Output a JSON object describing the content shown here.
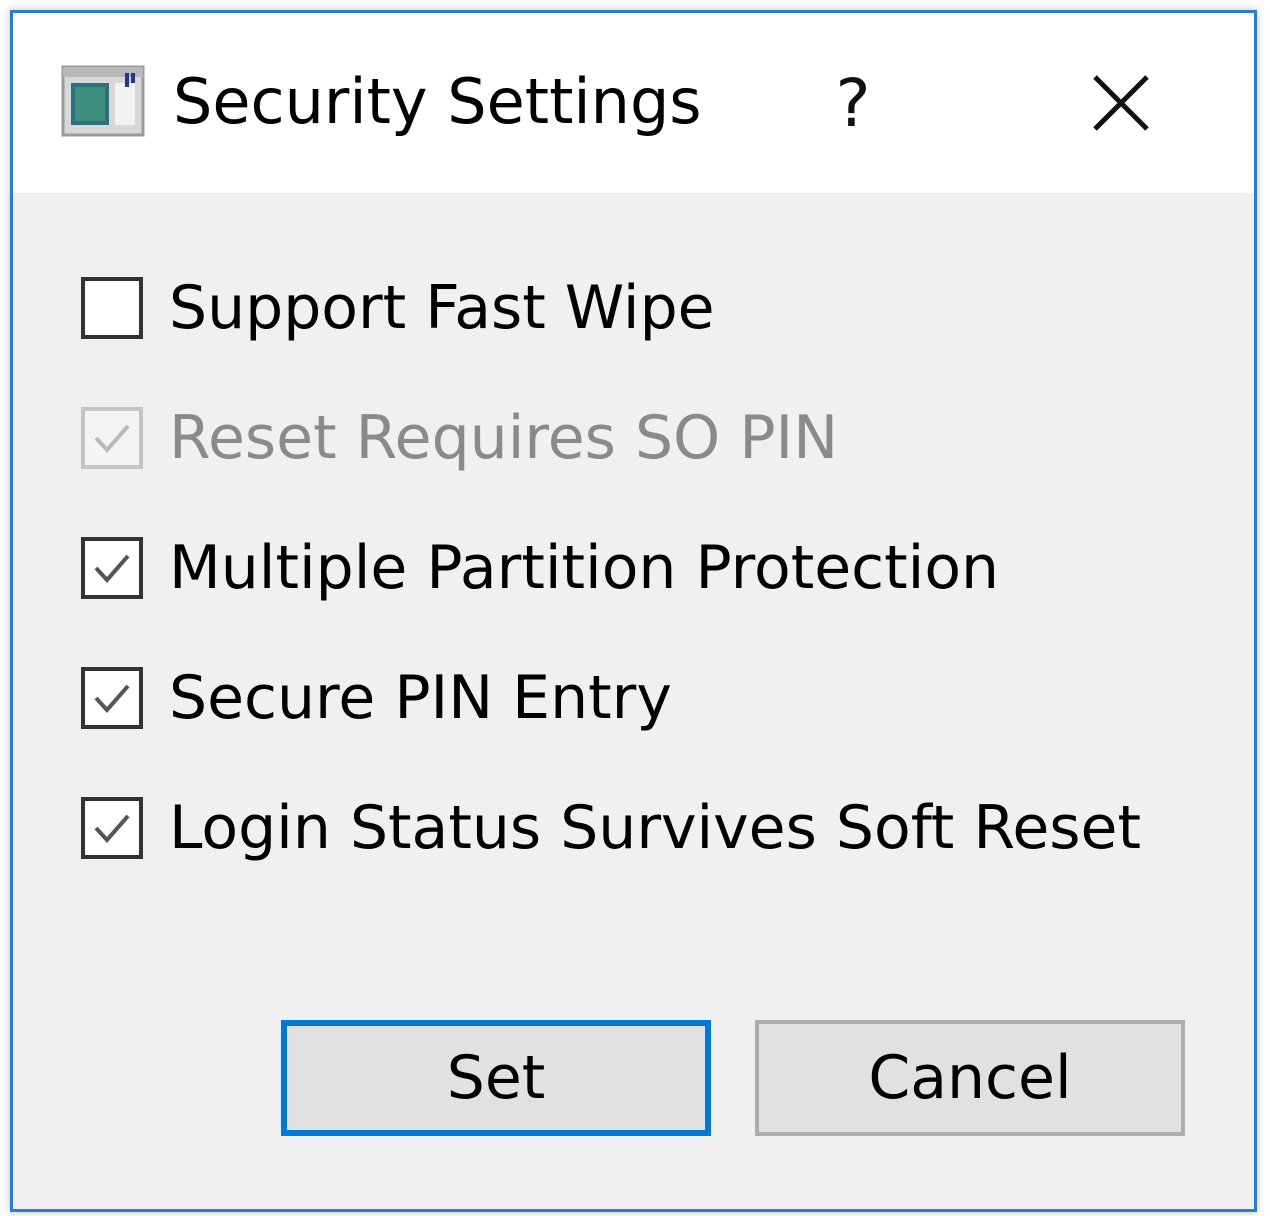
{
  "window": {
    "title": "Security Settings",
    "help_label": "?",
    "close_icon": "close-icon",
    "app_icon": "window-app-icon"
  },
  "options": [
    {
      "label": "Support Fast Wipe",
      "checked": false,
      "enabled": true
    },
    {
      "label": "Reset Requires SO PIN",
      "checked": true,
      "enabled": false
    },
    {
      "label": "Multiple Partition Protection",
      "checked": true,
      "enabled": true
    },
    {
      "label": "Secure PIN Entry",
      "checked": true,
      "enabled": true
    },
    {
      "label": "Login Status Survives Soft Reset",
      "checked": true,
      "enabled": true
    }
  ],
  "buttons": {
    "set_label": "Set",
    "cancel_label": "Cancel"
  },
  "colors": {
    "accent": "#0078d7",
    "window_border": "#2b7bd6",
    "dialog_bg": "#f0f0f0",
    "disabled_text": "#8a8a8a"
  }
}
